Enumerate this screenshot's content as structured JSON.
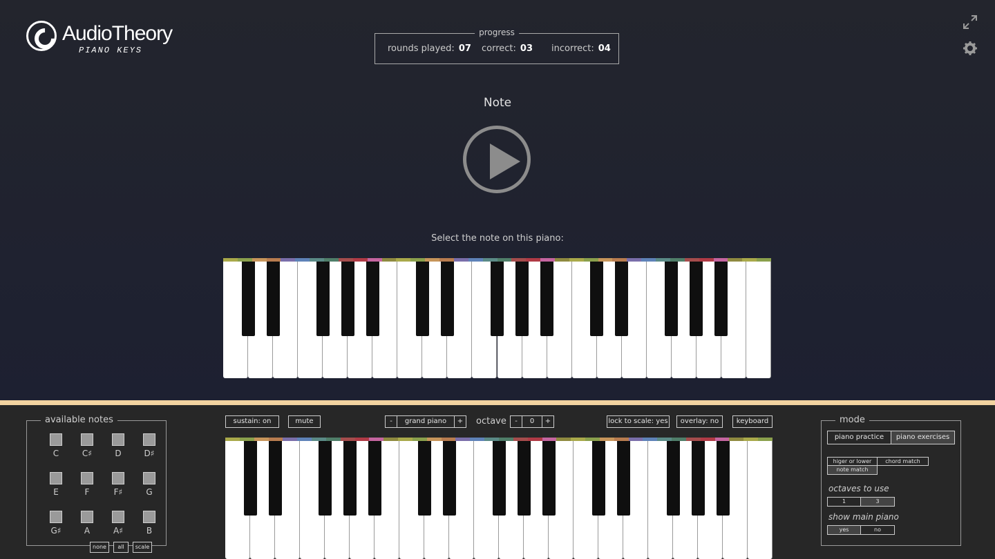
{
  "logo": {
    "name": "AudioTheory",
    "subtitle": "PIANO KEYS"
  },
  "progress": {
    "title": "progress",
    "rounds_label": "rounds played:",
    "rounds_value": "07",
    "correct_label": "correct:",
    "correct_value": "03",
    "incorrect_label": "incorrect:",
    "incorrect_value": "04"
  },
  "icons": {
    "expand": "expand-icon",
    "settings": "gear-icon",
    "play": "play-icon"
  },
  "main": {
    "title": "Note",
    "instruction": "Select the note on this piano:"
  },
  "available_notes": {
    "title": "available notes",
    "notes": [
      "C",
      "C♯",
      "D",
      "D♯",
      "E",
      "F",
      "F♯",
      "G",
      "G♯",
      "A",
      "A♯",
      "B"
    ],
    "buttons": [
      "none",
      "all",
      "scale"
    ]
  },
  "controls": {
    "sustain": "sustain: on",
    "mute": "mute",
    "minus": "-",
    "instrument": "grand piano",
    "plus": "+",
    "octave_label": "octave",
    "octave_value": "0",
    "lock": "lock to scale: yes",
    "overlay": "overlay: no",
    "keyboard": "keyboard"
  },
  "mode": {
    "title": "mode",
    "tabs": [
      "piano practice",
      "piano exercises"
    ],
    "exercises": [
      "higer or lower",
      "chord match",
      "note match"
    ],
    "octaves_label": "octaves to use",
    "octaves": [
      "1",
      "3"
    ],
    "show_label": "show main piano",
    "show": [
      "yes",
      "no"
    ]
  },
  "colors": {
    "background_top": "#23252d",
    "divider": "#f2d3a0",
    "panel": "#272727",
    "note_strip": [
      "#a9a94a",
      "#8aa04c",
      "#c7955a",
      "#b87c4f",
      "#7a6eaa",
      "#5e82b8",
      "#5a8a86",
      "#4f7e69",
      "#a54c4c",
      "#b03a45",
      "#c565a0",
      "#8f8a40"
    ]
  }
}
